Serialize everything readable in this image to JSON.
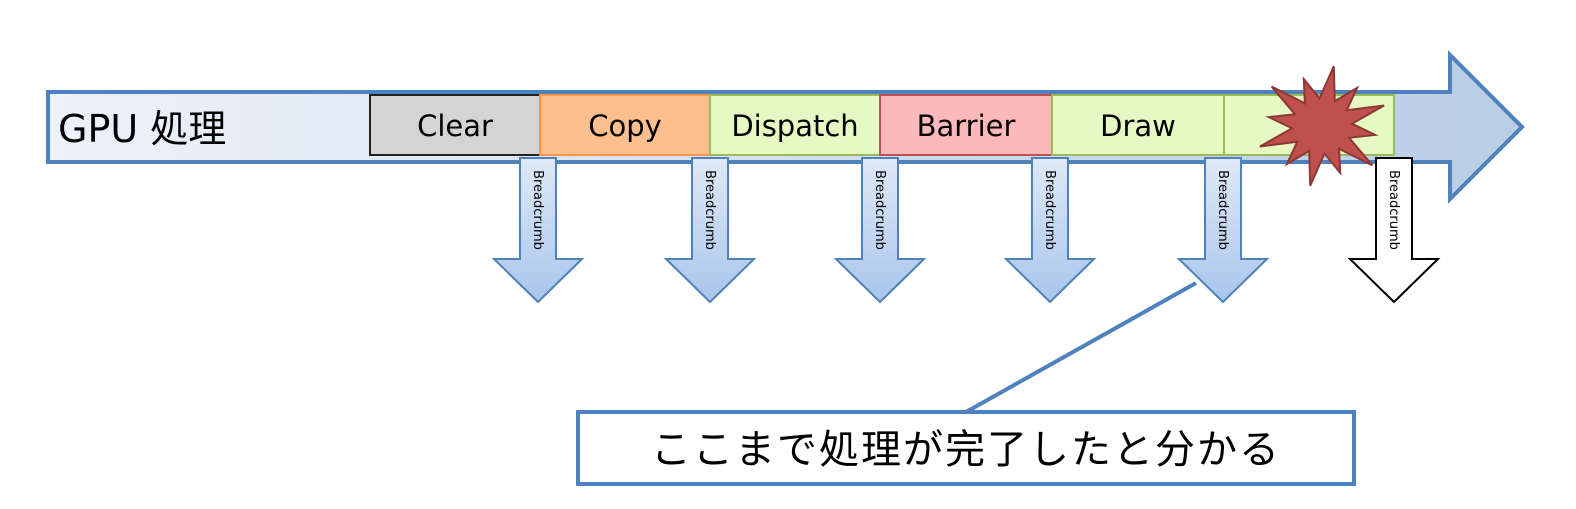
{
  "timeline": {
    "title": "GPU 処理",
    "steps": [
      {
        "label": "Clear",
        "fill": "#d4d4d4",
        "stroke": "#222222"
      },
      {
        "label": "Copy",
        "fill": "#fdbf8e",
        "stroke": "#f79646"
      },
      {
        "label": "Dispatch",
        "fill": "#e6f9c2",
        "stroke": "#9bbb59"
      },
      {
        "label": "Barrier",
        "fill": "#fcb9bc",
        "stroke": "#c0504d"
      },
      {
        "label": "Draw",
        "fill": "#e6f9c2",
        "stroke": "#9bbb59"
      },
      {
        "label": "",
        "fill": "#e6f9c2",
        "stroke": "#9bbb59"
      }
    ]
  },
  "breadcrumbs": [
    {
      "label": "Breadcrumb",
      "style": "filled"
    },
    {
      "label": "Breadcrumb",
      "style": "filled"
    },
    {
      "label": "Breadcrumb",
      "style": "filled"
    },
    {
      "label": "Breadcrumb",
      "style": "filled"
    },
    {
      "label": "Breadcrumb",
      "style": "filled"
    },
    {
      "label": "Breadcrumb",
      "style": "outline"
    }
  ],
  "callout": {
    "text": "ここまで処理が完了したと分かる"
  },
  "colors": {
    "accent": "#4f81bd",
    "crash": "#c0504d",
    "crash_stroke": "#8c3836"
  },
  "icons": {
    "crash": "explosion-burst-icon"
  }
}
